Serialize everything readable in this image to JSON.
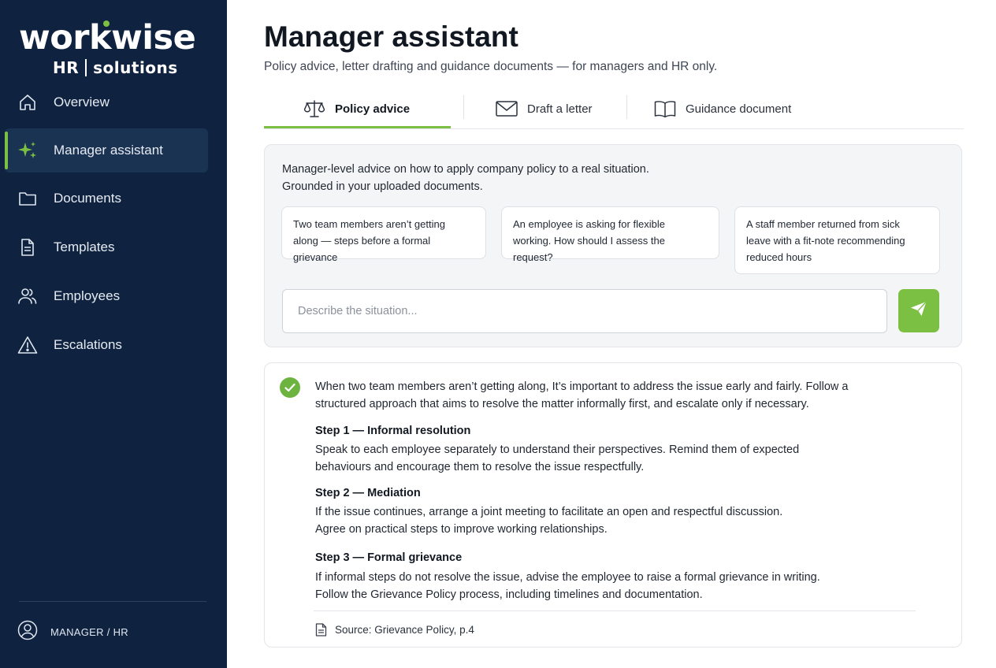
{
  "brand": {
    "name": "workwise",
    "sub_left": "HR",
    "sub_right": "solutions",
    "accent": "#7bc043",
    "sidebar_bg": "#0f2340"
  },
  "sidebar": {
    "items": [
      {
        "label": "Overview",
        "icon": "home-icon",
        "active": false
      },
      {
        "label": "Manager assistant",
        "icon": "sparkle-icon",
        "active": true
      },
      {
        "label": "Documents",
        "icon": "folder-icon",
        "active": false
      },
      {
        "label": "Templates",
        "icon": "document-icon",
        "active": false
      },
      {
        "label": "Employees",
        "icon": "users-icon",
        "active": false
      },
      {
        "label": "Escalations",
        "icon": "warning-icon",
        "active": false
      }
    ],
    "user_role": "MANAGER / HR"
  },
  "header": {
    "title": "Manager assistant",
    "subtitle": "Policy advice, letter drafting and guidance documents — for managers and HR only."
  },
  "tabs": [
    {
      "label": "Policy advice",
      "icon": "scales-icon",
      "active": true
    },
    {
      "label": "Draft a letter",
      "icon": "envelope-icon",
      "active": false
    },
    {
      "label": "Guidance document",
      "icon": "book-icon",
      "active": false
    }
  ],
  "prompt": {
    "intro_line1": "Manager-level advice on how to apply company policy to a real situation.",
    "intro_line2": "Grounded in your uploaded documents.",
    "suggestions": [
      {
        "line1": "Two team members aren’t getting",
        "line2": "along — steps before a formal grievance"
      },
      {
        "line1": "An employee is asking for flexible",
        "line2": "working. How should I assess the request?"
      },
      {
        "line1": "A staff member returned from sick",
        "line2": "leave with a fit-note recommending",
        "line3": "reduced hours"
      }
    ],
    "input_placeholder": "Describe the situation...",
    "input_value": "",
    "send_icon": "send-icon"
  },
  "answer": {
    "intro_line1": "When two team members aren’t getting along, It’s important to address the issue early and fairly. Follow a",
    "intro_line2": "structured approach that aims to resolve the matter informally first, and escalate only if necessary.",
    "steps": [
      {
        "heading": "Step 1 — Informal resolution",
        "line1": "Speak to each employee separately to understand their perspectives. Remind them of expected",
        "line2": "behaviours and encourage them to resolve the issue respectfully."
      },
      {
        "heading": "Step 2 — Mediation",
        "line1": "If the issue continues, arrange a joint meeting to facilitate an open and respectful discussion.",
        "line2": "Agree on practical steps to improve working relationships."
      },
      {
        "heading": "Step 3 — Formal grievance",
        "line1": "If informal steps do not resolve the issue, advise the employee to raise a formal grievance in writing.",
        "line2": "Follow the Grievance Policy process, including timelines and documentation."
      }
    ],
    "source": "Source: Grievance Policy, p.4"
  }
}
